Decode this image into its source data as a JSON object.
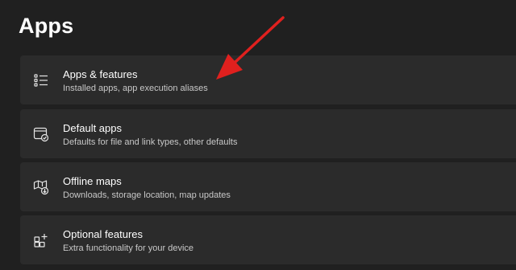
{
  "page": {
    "title": "Apps"
  },
  "items": [
    {
      "label": "Apps & features",
      "description": "Installed apps, app execution aliases",
      "icon": "apps-list-icon"
    },
    {
      "label": "Default apps",
      "description": "Defaults for file and link types, other defaults",
      "icon": "default-apps-icon"
    },
    {
      "label": "Offline maps",
      "description": "Downloads, storage location, map updates",
      "icon": "offline-map-icon"
    },
    {
      "label": "Optional features",
      "description": "Extra functionality for your device",
      "icon": "optional-features-icon"
    }
  ],
  "colors": {
    "background": "#202020",
    "card": "#2b2b2b",
    "arrow": "#e0201e"
  }
}
